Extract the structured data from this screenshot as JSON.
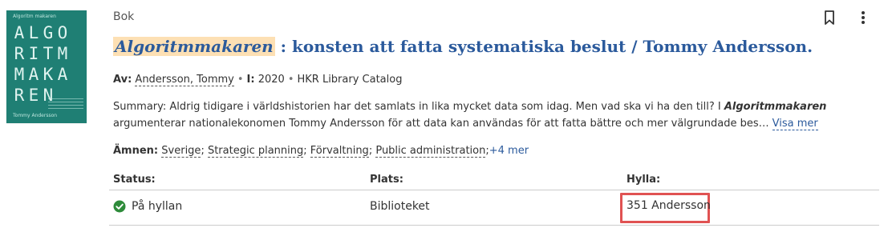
{
  "record": {
    "format": "Bok",
    "title_highlight": "Algoritmmakaren",
    "title_rest": " : konsten att fatta systematiska beslut / Tommy Andersson.",
    "byline": {
      "by_label": "Av:",
      "author": "Andersson, Tommy",
      "year_label": "I:",
      "year": "2020",
      "source": "HKR Library Catalog"
    },
    "summary": {
      "lead": "Summary: Aldrig tidigare i världshistorien har det samlats in lika mycket data som idag. Men vad ska vi ha den till? I ",
      "highlight": "Algoritmmakaren",
      "tail": " argumenterar nationalekonomen Tommy Andersson för att data kan användas för att fatta bättre och mer välgrundade bes…",
      "show_more": "Visa mer"
    },
    "subjects": {
      "label": "Ämnen:",
      "items": [
        "Sverige",
        "Strategic planning",
        "Förvaltning",
        "Public administration"
      ],
      "more": "+4 mer"
    },
    "holdings": {
      "headers": [
        "Status:",
        "Plats:",
        "Hylla:"
      ],
      "status": "På hyllan",
      "location": "Biblioteket",
      "shelf": "351 Andersson"
    }
  },
  "cover": {
    "top_text": "Algoritm makaren",
    "letters": [
      "A",
      "L",
      "G",
      "O",
      "R",
      "I",
      "T",
      "M",
      "M",
      "A",
      "K",
      "A",
      "R",
      "E",
      "N"
    ],
    "author_text": "Tommy Andersson"
  },
  "icons": {
    "bookmark": "bookmark-icon",
    "more": "more-vertical-icon",
    "status": "check-circle-icon"
  },
  "colors": {
    "accent": "#2b5a9c",
    "highlight": "#fde0b4",
    "status_green": "#2e8b3a",
    "focus_red": "#e05252"
  }
}
